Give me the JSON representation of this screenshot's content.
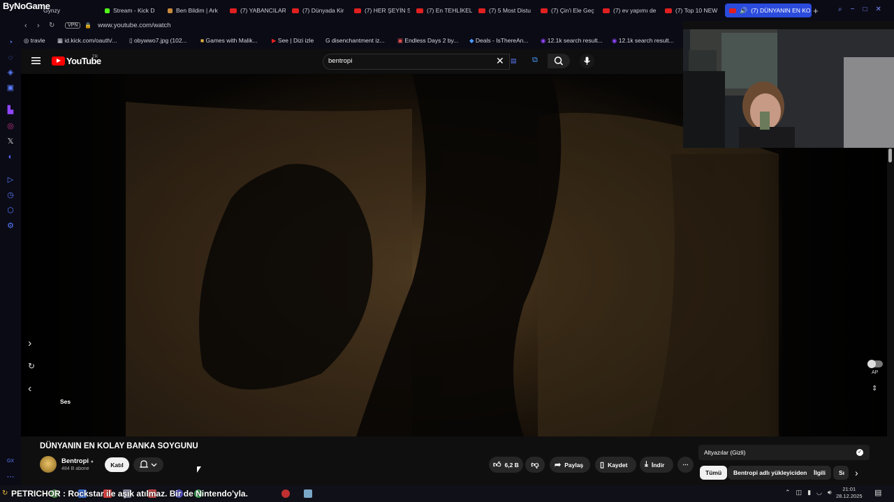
{
  "overlay_logo": "ByNoGame",
  "tabs": [
    {
      "label": "Gynzy",
      "active": false
    },
    {
      "label": "Stream - Kick D",
      "active": false
    },
    {
      "label": "Ben Bildim | Ark",
      "active": false
    },
    {
      "label": "(7) YABANCILAR",
      "active": false
    },
    {
      "label": "(7) Dünyada Kir",
      "active": false
    },
    {
      "label": "(7) HER ŞEYİN S",
      "active": false
    },
    {
      "label": "(7) En TEHLİKEL",
      "active": false
    },
    {
      "label": "(7) 5 Most Distu",
      "active": false
    },
    {
      "label": "(7) Çin'i Ele Geç",
      "active": false
    },
    {
      "label": "(7) ev yapımı de",
      "active": false
    },
    {
      "label": "(7) Top 10 NEW",
      "active": false
    },
    {
      "label": "(7) DÜNYANIN EN KO",
      "active": true
    }
  ],
  "address": {
    "vpn": "VPN",
    "url": "www.youtube.com/watch"
  },
  "bookmarks": [
    "travle",
    "id.kick.com/oauth/...",
    "obywwo7.jpg (102...",
    "Games with Malik...",
    "See | Dizi izle",
    "disenchantment iz...",
    "Endless Days 2 by...",
    "Deals - IsThereAn...",
    "12.1k search result...",
    "12.1k search result..."
  ],
  "youtube": {
    "logo": "YouTube",
    "logo_country": "TR",
    "search_value": "bentropi"
  },
  "player": {
    "side_label_left": "Ses",
    "autoplay_label": "AP"
  },
  "video": {
    "title": "DÜNYANIN EN KOLAY BANKA SOYGUNU",
    "channel": "Bentropi",
    "subscribers": "484 B abone",
    "join_label": "Katıl",
    "like_count": "6,2 B",
    "share_label": "Paylaş",
    "save_label": "Kaydet",
    "download_label": "İndir"
  },
  "sidebar_panel": {
    "subtitles_label": "Altyazılar (Gizli)",
    "chips": [
      "Tümü",
      "Bentropi adlı yükleyiciden",
      "İlgili",
      "Sı"
    ]
  },
  "taskbar": {
    "ticker": "PETRICHOR : Rockstar ile aşık atılmaz. Bir de Nintendo'yla.",
    "time": "21:01",
    "date": "28.12.2025"
  }
}
